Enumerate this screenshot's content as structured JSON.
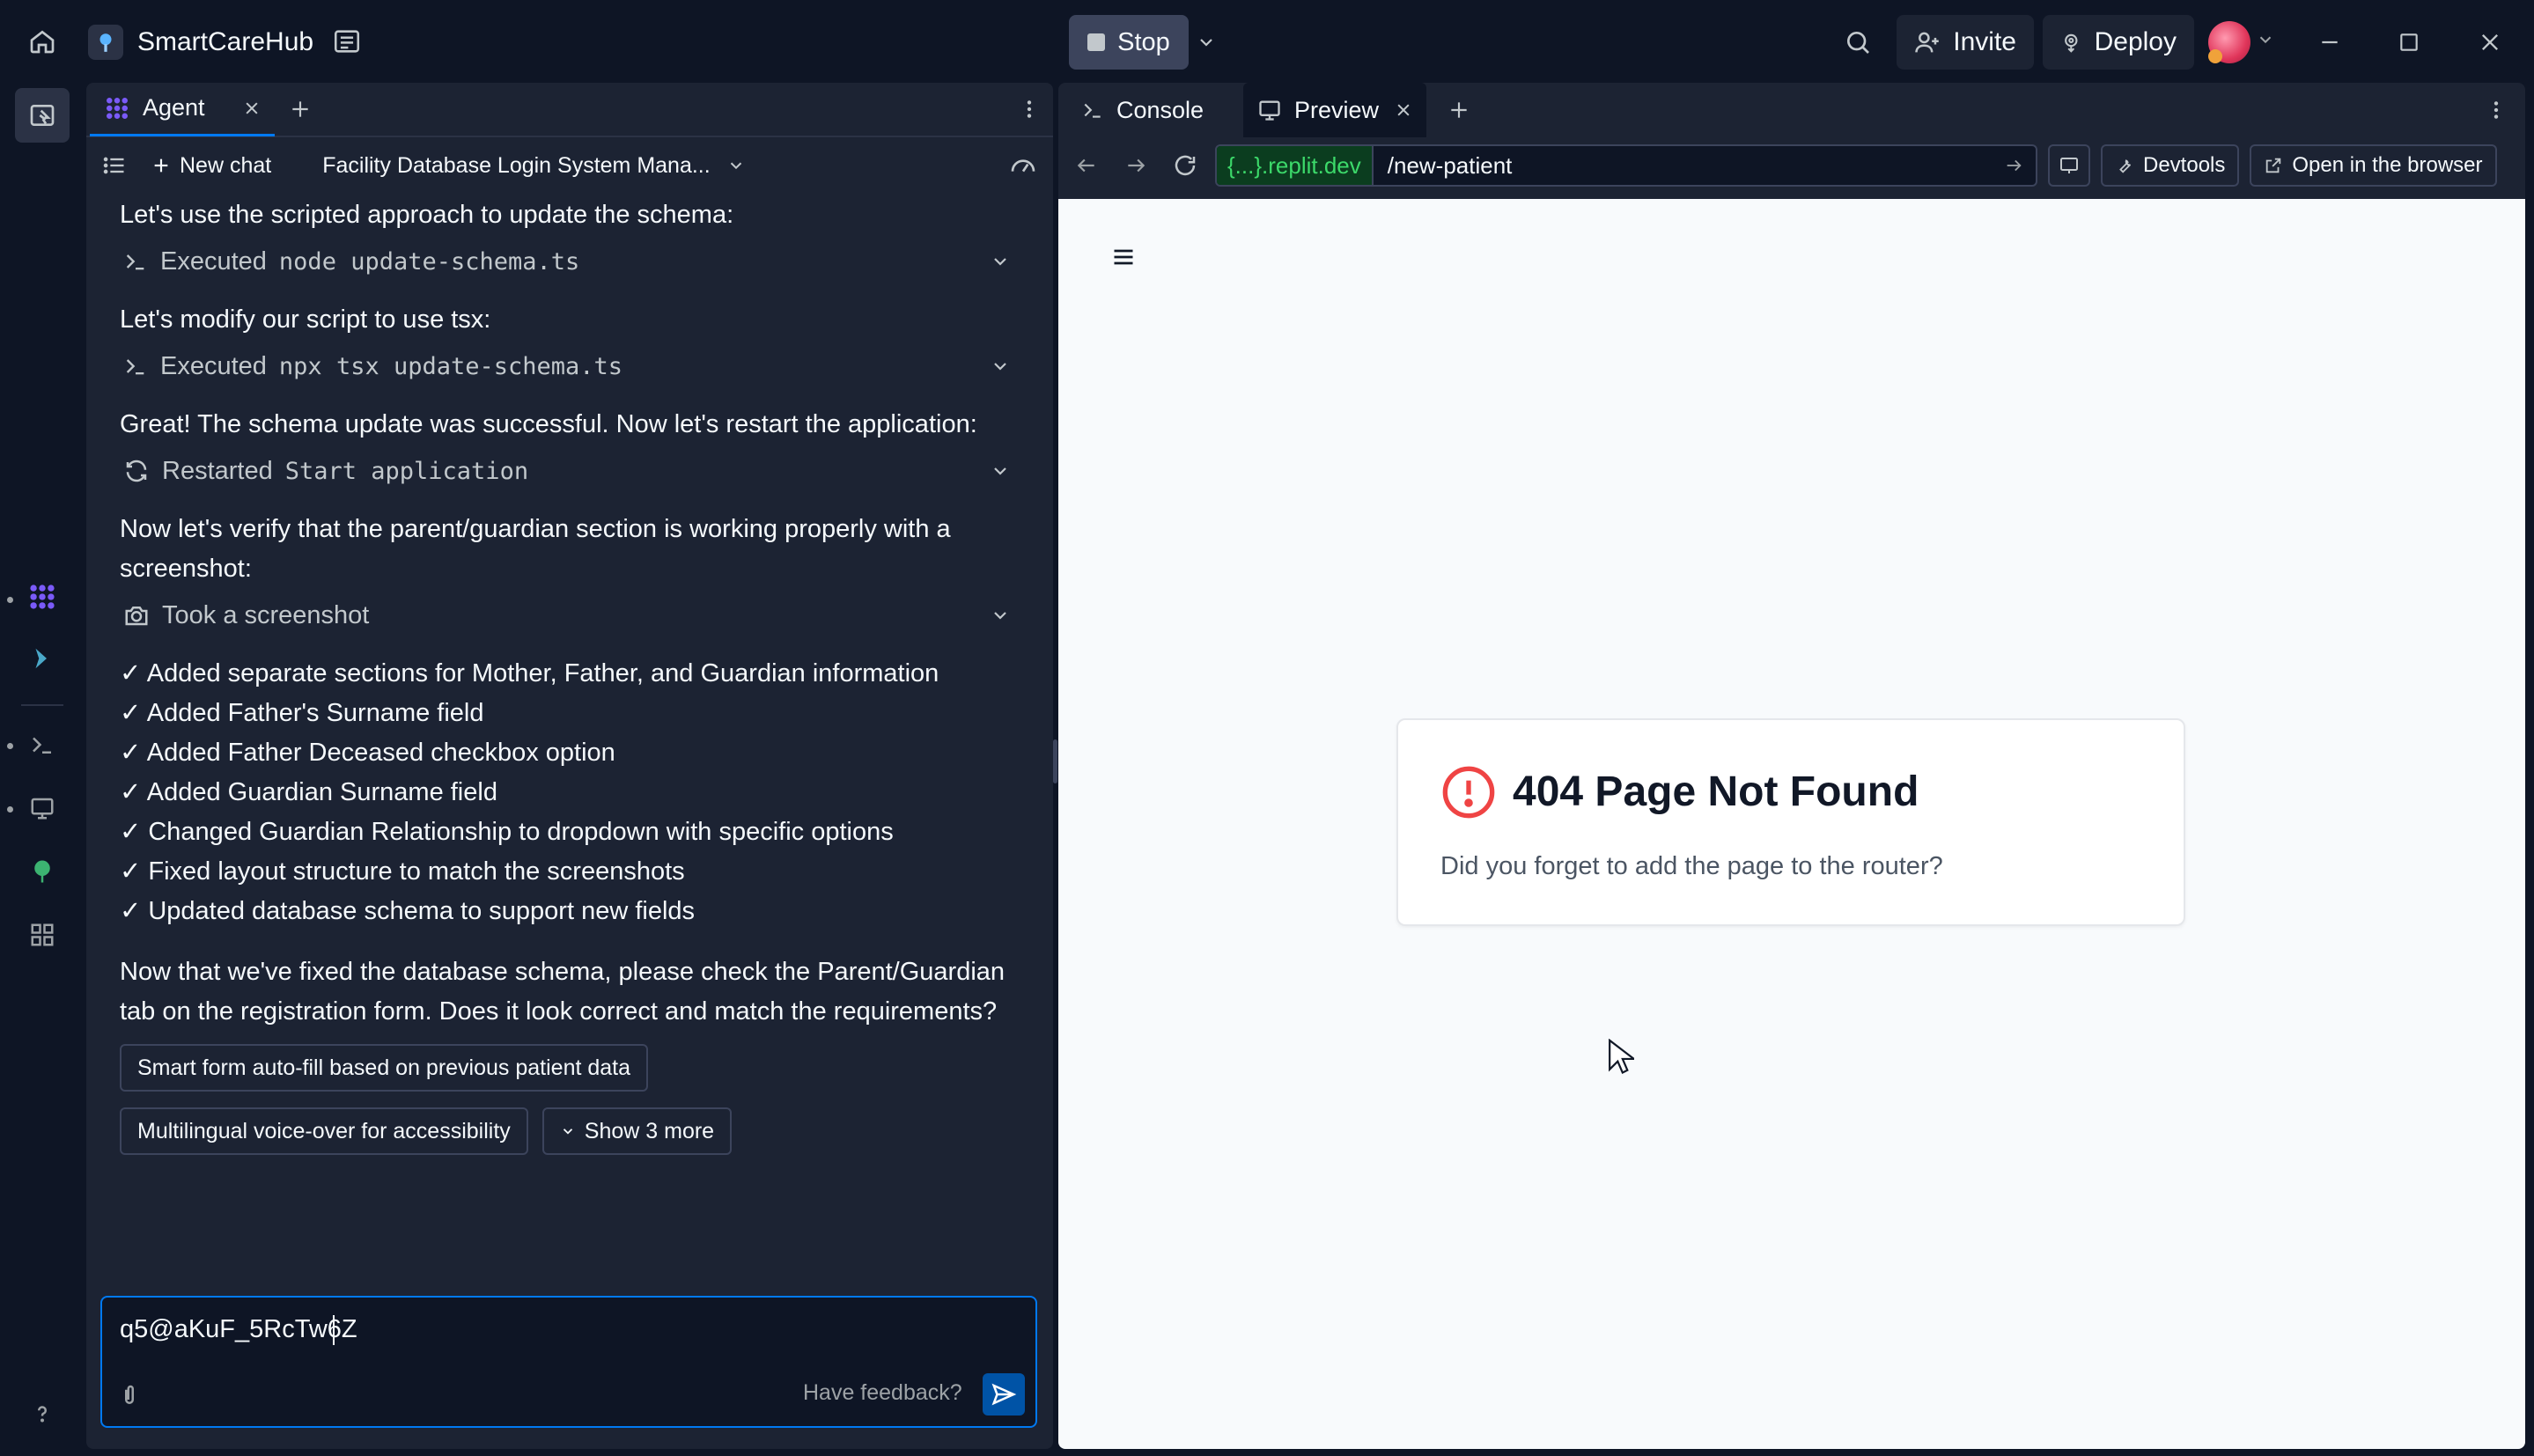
{
  "titlebar": {
    "project_name": "SmartCareHub",
    "stop_label": "Stop",
    "invite_label": "Invite",
    "deploy_label": "Deploy"
  },
  "agent_panel": {
    "tab_label": "Agent",
    "new_chat_label": "New chat",
    "chat_title": "Facility Database Login System Mana...",
    "messages": {
      "m1": "Let's use the scripted approach to update the schema:",
      "a1_prefix": "Executed",
      "a1_cmd": "node update-schema.ts",
      "m2": "Let's modify our script to use tsx:",
      "a2_prefix": "Executed",
      "a2_cmd": "npx tsx update-schema.ts",
      "m3": "Great! The schema update was successful. Now let's restart the application:",
      "a3_prefix": "Restarted",
      "a3_cmd": "Start application",
      "m4": "Now let's verify that the parent/guardian section is working properly with a screenshot:",
      "a4": "Took a screenshot",
      "checklist": [
        "✓ Added separate sections for Mother, Father, and Guardian information",
        "✓ Added Father's Surname field",
        "✓ Added Father Deceased checkbox option",
        "✓ Added Guardian Surname field",
        "✓ Changed Guardian Relationship to dropdown with specific options",
        "✓ Fixed layout structure to match the screenshots",
        "✓ Updated database schema to support new fields"
      ],
      "m5": "Now that we've fixed the database schema, please check the Parent/Guardian tab on the registration form. Does it look correct and match the requirements?"
    },
    "suggestions": {
      "s1": "Smart form auto-fill based on previous patient data",
      "s2": "Multilingual voice-over for accessibility",
      "show_more": "Show 3 more"
    },
    "input": {
      "value": "q5@aKuF_5RcTw6Z",
      "feedback_label": "Have feedback?"
    }
  },
  "preview_panel": {
    "tabs": {
      "console": "Console",
      "preview": "Preview"
    },
    "url": {
      "domain": "{...}.replit.dev",
      "path": "/new-patient"
    },
    "devtools_label": "Devtools",
    "open_browser_label": "Open in the browser",
    "page": {
      "title": "404 Page Not Found",
      "description": "Did you forget to add the page to the router?"
    }
  },
  "colors": {
    "accent": "#0079f2",
    "domain_green": "#3cd96a",
    "error_red": "#ef4444",
    "agent_purple": "#7a5af8"
  }
}
